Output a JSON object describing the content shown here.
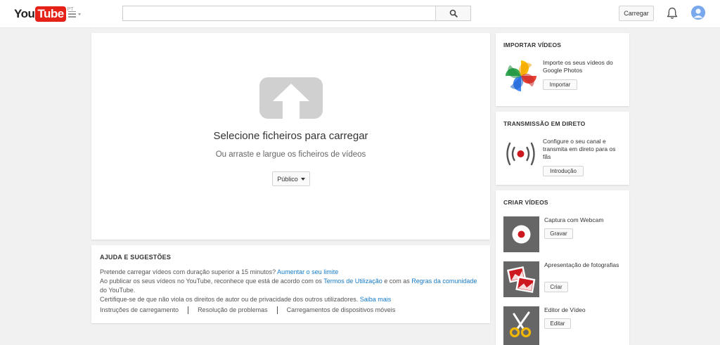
{
  "header": {
    "logo_you": "You",
    "logo_tube": "Tube",
    "logo_country": "PT",
    "search_placeholder": "",
    "search_value": "",
    "upload_label": "Carregar"
  },
  "upload": {
    "title": "Selecione ficheiros para carregar",
    "subtitle": "Ou arraste e largue os ficheiros de vídeos",
    "privacy_value": "Público"
  },
  "help": {
    "title": "AJUDA E SUGESTÕES",
    "line1_text": "Pretende carregar vídeos com duração superior a 15 minutos?",
    "line1_link": "Aumentar o seu limite",
    "line2_a": "Ao publicar os seus vídeos no YouTube, reconhece que está de acordo com os",
    "line2_link1": "Termos de Utilização",
    "line2_b": "e com as",
    "line2_link2": "Regras da comunidade",
    "line3": "do YouTube.",
    "line4_text": "Certifique-se de que não viola os direitos de autor ou de privacidade dos outros utilizadores.",
    "line4_link": "Saiba mais",
    "links": [
      "Instruções de carregamento",
      "Resolução de problemas",
      "Carregamentos de dispositivos móveis"
    ]
  },
  "sidebar": {
    "import": {
      "title": "IMPORTAR VÍDEOS",
      "text": "Importe os seus vídeos do Google Photos",
      "button": "Importar"
    },
    "live": {
      "title": "TRANSMISSÃO EM DIRETO",
      "text": "Configure o seu canal e transmita em direto para os fãs",
      "button": "Introdução"
    },
    "create": {
      "title": "CRIAR VÍDEOS",
      "items": [
        {
          "label": "Captura com Webcam",
          "button": "Gravar"
        },
        {
          "label": "Apresentação de fotografias",
          "button": "Criar"
        },
        {
          "label": "Editor de Vídeo",
          "button": "Editar"
        }
      ]
    }
  },
  "colors": {
    "brand_red": "#e62117",
    "link_blue": "#167ac6",
    "tile_gray": "#666666"
  },
  "icons": [
    "menu-icon",
    "search-icon",
    "bell-icon",
    "avatar",
    "upload-arrow-icon",
    "google-photos-icon",
    "live-broadcast-icon",
    "webcam-icon",
    "photo-slideshow-icon",
    "scissors-icon"
  ]
}
